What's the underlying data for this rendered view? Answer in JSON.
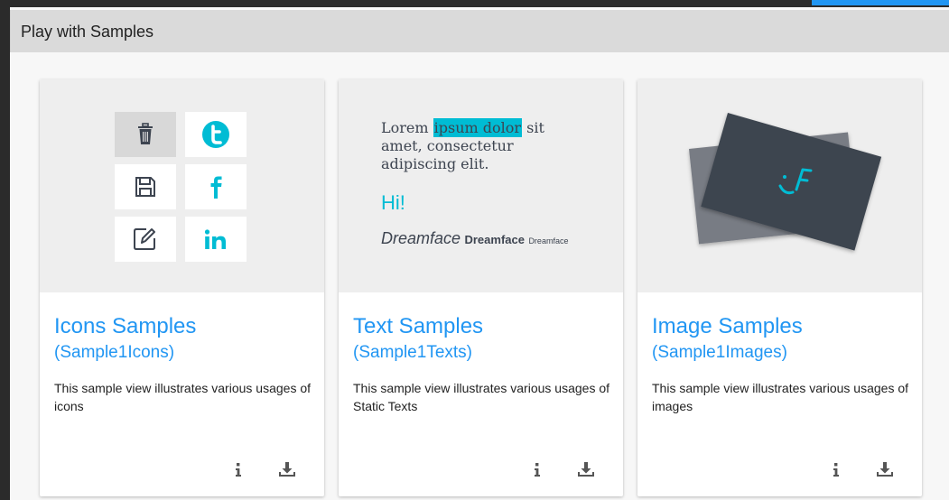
{
  "header": {
    "title": "Play with Samples"
  },
  "colors": {
    "accent": "#2196f3",
    "cyan": "#00bcd4",
    "slate": "#3d4450"
  },
  "cards": [
    {
      "title": "Icons Samples",
      "subtitle": "(Sample1Icons)",
      "description": "This sample view illustrates various usages of icons",
      "icons": [
        "trash-icon",
        "twitter-icon",
        "save-icon",
        "facebook-icon",
        "edit-icon",
        "linkedin-icon"
      ]
    },
    {
      "title": "Text Samples",
      "subtitle": "(Sample1Texts)",
      "description": "This sample view illustrates various usages of Static Texts",
      "preview": {
        "lorem_before": "Lorem ",
        "lorem_highlight": "ipsum dolor",
        "lorem_after": " sit amet, consectetur adipiscing elit.",
        "greeting": "Hi!",
        "brand_large": "Dreamface",
        "brand_medium": "Dreamface",
        "brand_small": "Dreamface"
      }
    },
    {
      "title": "Image Samples",
      "subtitle": "(Sample1Images)",
      "description": "This sample view illustrates various usages of images",
      "preview_icon": "dreamface-logo-icon"
    }
  ],
  "actions": {
    "info_icon": "info-icon",
    "download_icon": "download-icon"
  }
}
